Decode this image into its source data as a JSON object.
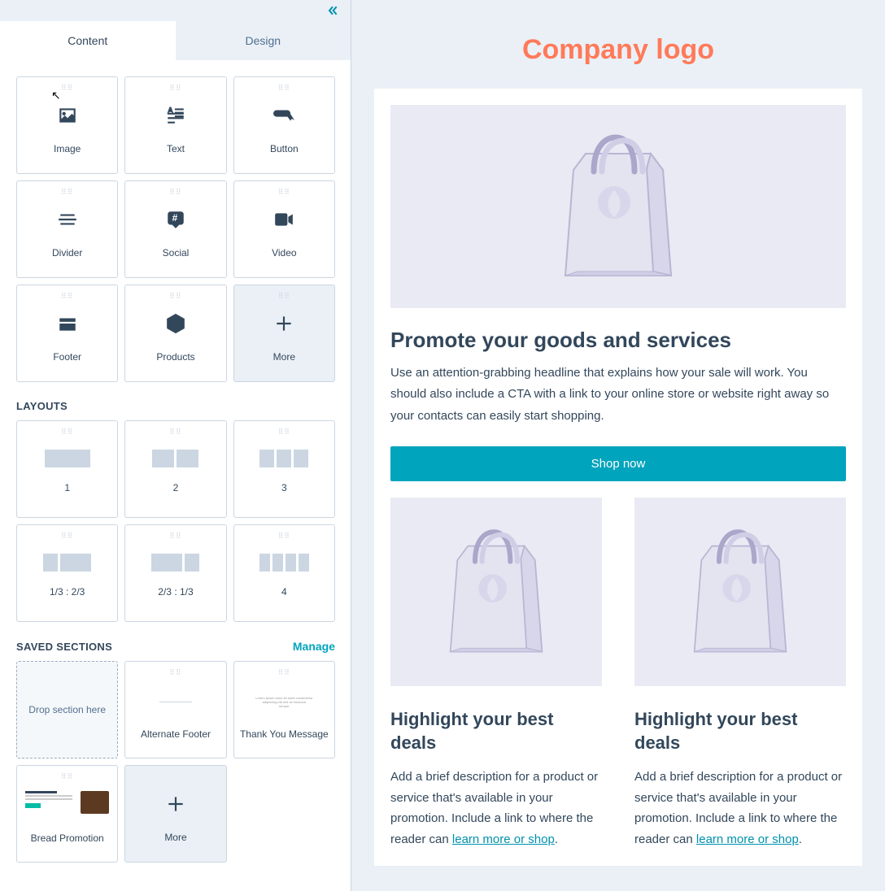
{
  "tabs": {
    "content": "Content",
    "design": "Design"
  },
  "blocks": {
    "image": "Image",
    "text": "Text",
    "button": "Button",
    "divider": "Divider",
    "social": "Social",
    "video": "Video",
    "footer": "Footer",
    "products": "Products",
    "more": "More"
  },
  "layouts_title": "LAYOUTS",
  "layouts": {
    "l1": "1",
    "l2": "2",
    "l3": "3",
    "l13_23": "1/3 : 2/3",
    "l23_13": "2/3 : 1/3",
    "l4": "4"
  },
  "saved": {
    "title": "SAVED SECTIONS",
    "manage": "Manage",
    "drop": "Drop section here",
    "alt_footer": "Alternate Footer",
    "thank_you": "Thank You Message",
    "bread": "Bread Promotion",
    "more": "More"
  },
  "email": {
    "logo": "Company logo",
    "h1": "Promote your goods and services",
    "p1": "Use an attention-grabbing headline that explains how your sale will work. You should also include a CTA with a link to your online store or website right away so your contacts can easily start shopping.",
    "cta": "Shop now",
    "col_h": "Highlight your best deals",
    "col_p_a": "Add a brief description for a product or service that's available in your promotion. Include a link to where the reader can ",
    "col_link": "learn more or shop",
    "col_p_b": "."
  }
}
